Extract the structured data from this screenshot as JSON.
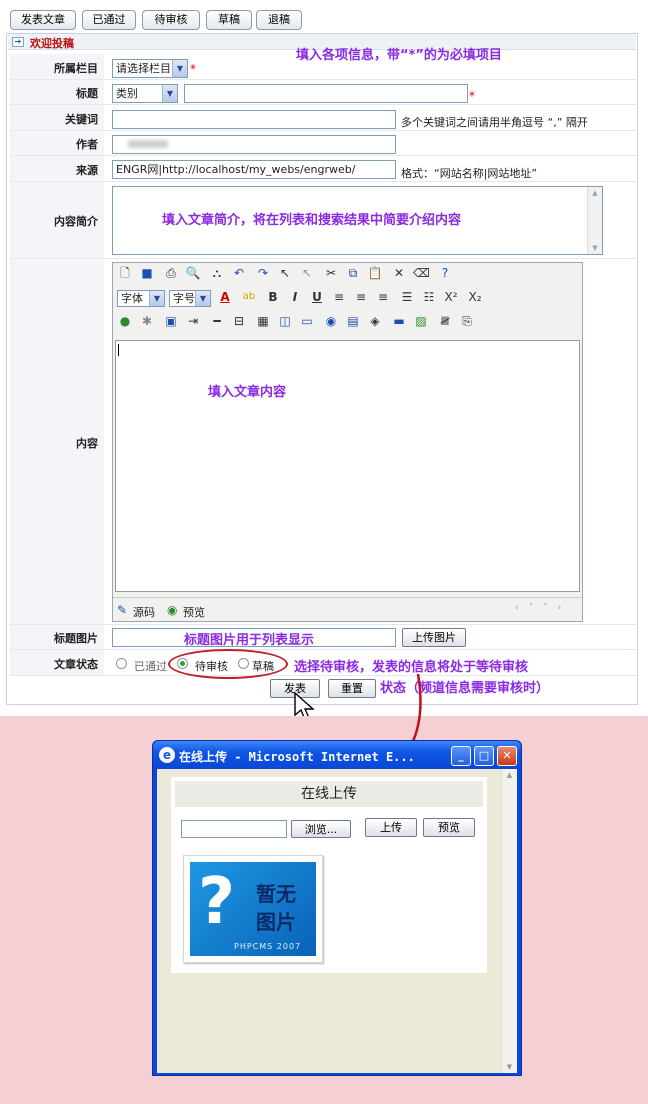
{
  "toolbar": {
    "tabs": [
      "发表文章",
      "已通过",
      "待审核",
      "草稿",
      "退稿"
    ]
  },
  "section": {
    "title": "欢迎投稿"
  },
  "hint_required": "填入各项信息，带“*”的为必填项目",
  "form": {
    "column": {
      "label": "所属栏目",
      "value": "请选择栏目"
    },
    "title": {
      "label": "标题",
      "category": "类别",
      "value": ""
    },
    "keywords": {
      "label": "关键词",
      "value": "",
      "note": "多个关键词之间请用半角逗号 “,” 隔开"
    },
    "author": {
      "label": "作者",
      "value": ""
    },
    "source": {
      "label": "来源",
      "value": "ENGR网|http://localhost/my_webs/engrweb/",
      "note": "格式：“网站名称|网站地址”"
    },
    "summary": {
      "label": "内容简介",
      "hint": "填入文章简介，将在列表和搜索结果中简要介绍内容"
    },
    "content": {
      "label": "内容",
      "hint": "填入文章内容"
    },
    "editor": {
      "font": "字体",
      "size": "字号",
      "source_tab": "源码",
      "preview_tab": "预览"
    },
    "thumb": {
      "label": "标题图片",
      "hint": "标题图片用于列表显示",
      "upload": "上传图片"
    },
    "status": {
      "label": "文章状态",
      "options": [
        "已通过",
        "待审核",
        "草稿"
      ],
      "selected": "待审核",
      "hint_line1": "选择待审核，发表的信息将处于等待审核",
      "hint_line2": "状态（频道信息需要审核时）"
    },
    "submit": "发表",
    "reset": "重置"
  },
  "popup": {
    "window_title": "在线上传 - Microsoft Internet E...",
    "heading": "在线上传",
    "browse": "浏览...",
    "upload": "上传",
    "preview": "预览",
    "no_image_line1": "暂无",
    "no_image_line2": "图片",
    "no_image_brand": "PHPCMS 2007"
  }
}
